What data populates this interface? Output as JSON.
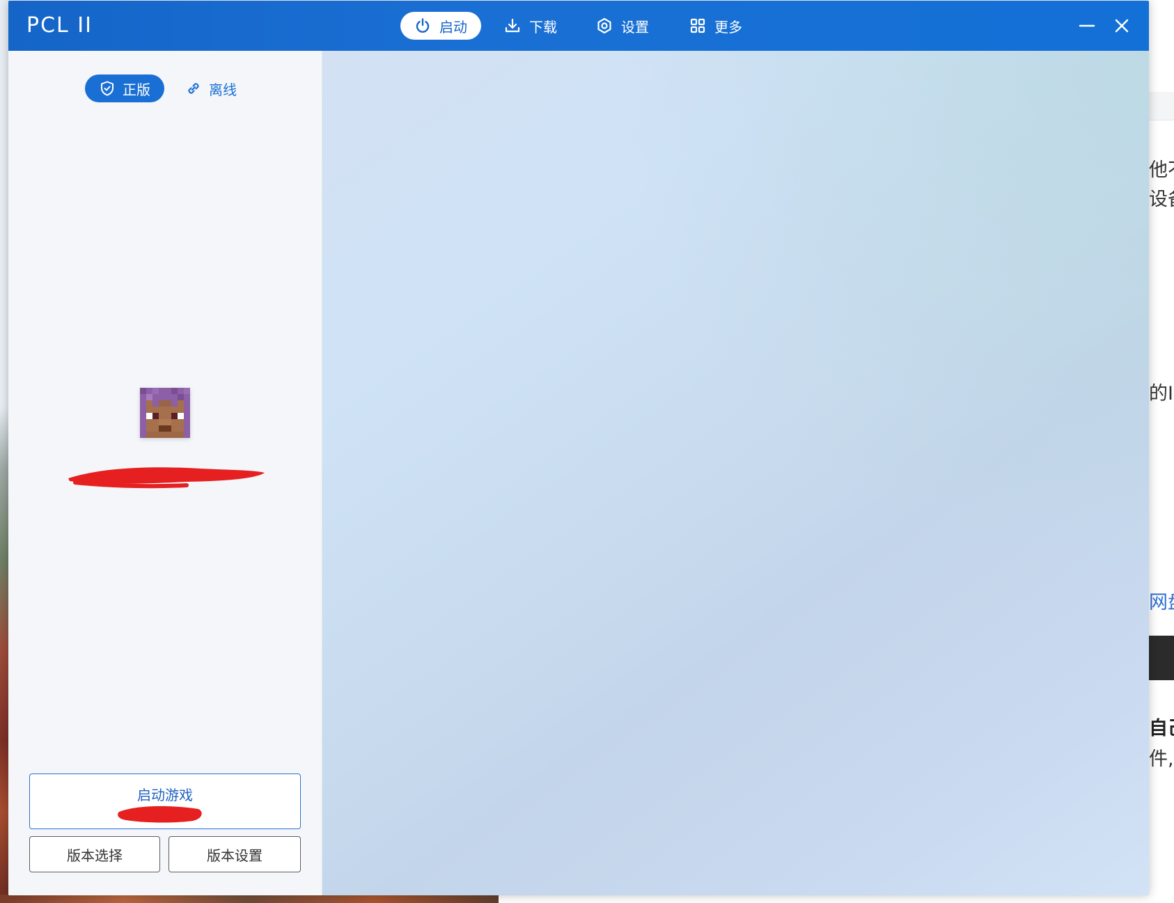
{
  "window": {
    "title": "PCL II",
    "nav": [
      {
        "label": "启动",
        "icon": "power-icon",
        "active": true
      },
      {
        "label": "下载",
        "icon": "download-icon",
        "active": false
      },
      {
        "label": "设置",
        "icon": "settings-icon",
        "active": false
      },
      {
        "label": "更多",
        "icon": "grid-icon",
        "active": false
      }
    ],
    "controls": [
      "minimize-icon",
      "close-icon"
    ]
  },
  "sidebar": {
    "login_modes": [
      {
        "label": "正版",
        "icon": "shield-check-icon",
        "active": true
      },
      {
        "label": "离线",
        "icon": "link-icon",
        "active": false
      }
    ],
    "launch_button": {
      "label": "启动游戏"
    },
    "version_select_label": "版本选择",
    "version_settings_label": "版本设置"
  },
  "background_window": {
    "text_fragments": [
      "他不",
      "设备",
      "的I",
      "网盘",
      "自己",
      "件,"
    ]
  },
  "colors": {
    "accent": "#1a6fd4",
    "titlebar": "#1565c8",
    "redaction": "#e62020"
  }
}
